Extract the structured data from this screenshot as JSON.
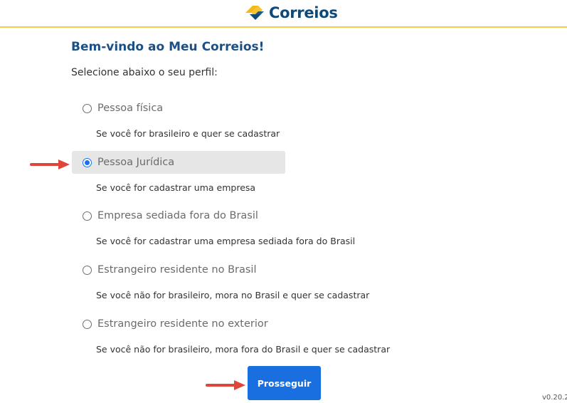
{
  "header": {
    "logo_text": "Correios",
    "accent_color": "#f6cb4a",
    "logo_colors": {
      "yellow": "#f6b80f",
      "blue": "#0b4a7a"
    }
  },
  "main": {
    "title": "Bem-vindo ao Meu Correios!",
    "subtitle": "Selecione abaixo o seu perfil:",
    "options": [
      {
        "label": "Pessoa física",
        "description": "Se você for brasileiro e quer se cadastrar",
        "selected": false
      },
      {
        "label": "Pessoa Jurídica",
        "description": "Se você for cadastrar uma empresa",
        "selected": true
      },
      {
        "label": "Empresa sediada fora do Brasil",
        "description": "Se você for cadastrar uma empresa sediada fora do Brasil",
        "selected": false
      },
      {
        "label": "Estrangeiro residente no Brasil",
        "description": "Se você não for brasileiro, mora no Brasil e quer se cadastrar",
        "selected": false
      },
      {
        "label": "Estrangeiro residente no exterior",
        "description": "Se você não for brasileiro, mora fora do Brasil e quer se cadastrar",
        "selected": false
      }
    ],
    "submit_label": "Prosseguir"
  },
  "annotations": {
    "arrow_color": "#e0453a",
    "arrow_icon": "right-arrow-icon"
  },
  "footer": {
    "version": "v0.20.2"
  }
}
